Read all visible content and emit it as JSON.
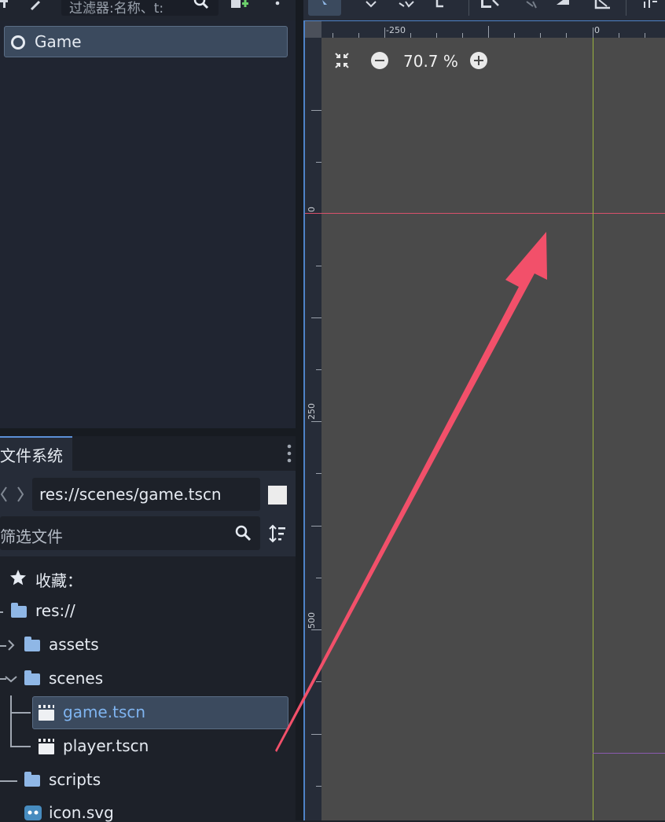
{
  "scene_panel": {
    "filter_placeholder": "过滤器:名称、t:",
    "root_node": "Game"
  },
  "filesystem": {
    "tab_label": "文件系统",
    "current_path": "res://scenes/game.tscn",
    "filter_placeholder": "筛选文件",
    "tree": {
      "favorites": "收藏：",
      "root": "res://",
      "assets": "assets",
      "scenes": "scenes",
      "game": "game.tscn",
      "player": "player.tscn",
      "scripts": "scripts",
      "icon": "icon.svg"
    }
  },
  "viewport": {
    "zoom": "70.7 %",
    "ruler_top_labels": [
      "-250",
      "0"
    ],
    "ruler_left_labels": [
      "0",
      "250",
      "500"
    ]
  },
  "colors": {
    "accent": "#5b8fd6",
    "selection": "#3b4a5e",
    "viewport_bg": "#4a4a4a",
    "x_axis": "#d8506b",
    "y_axis": "#9ab33e",
    "arrow": "#f2506a"
  }
}
